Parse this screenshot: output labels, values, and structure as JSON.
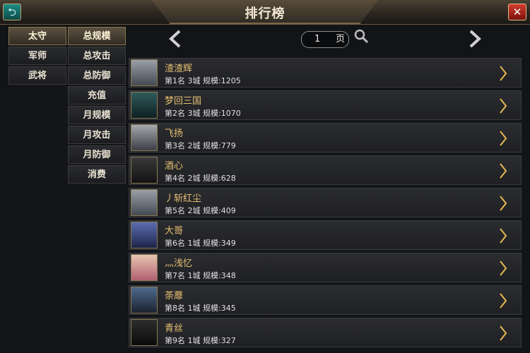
{
  "window": {
    "title": "排行榜"
  },
  "categories": [
    {
      "label": "太守"
    },
    {
      "label": "军师"
    },
    {
      "label": "武将"
    }
  ],
  "rank_types": [
    {
      "label": "总规模"
    },
    {
      "label": "总攻击"
    },
    {
      "label": "总防御"
    },
    {
      "label": "充值"
    },
    {
      "label": "月规模"
    },
    {
      "label": "月攻击"
    },
    {
      "label": "月防御"
    },
    {
      "label": "消费"
    }
  ],
  "pager": {
    "page": "1",
    "unit": "页"
  },
  "rows": [
    {
      "name": "渣渣辉",
      "info": "第1名 3城 规模:1205",
      "avatar": "helmet-warrior"
    },
    {
      "name": "梦回三国",
      "info": "第2名 3城 规模:1070",
      "avatar": "bearded-general"
    },
    {
      "name": "飞扬",
      "info": "第3名 2城 规模:779",
      "avatar": "silver-helmet-warrior"
    },
    {
      "name": "酒心",
      "info": "第4名 2城 规模:628",
      "avatar": "dark-haired-man"
    },
    {
      "name": "丿斩红尘",
      "info": "第5名 2城 规模:409",
      "avatar": "helmet-warrior"
    },
    {
      "name": "大哥",
      "info": "第6名 1城 规模:349",
      "avatar": "young-officer"
    },
    {
      "name": "灬浅忆",
      "info": "第7名 1城 规模:348",
      "avatar": "lady-pink"
    },
    {
      "name": "荼蘼",
      "info": "第8名 1城 规模:345",
      "avatar": "lady-dark"
    },
    {
      "name": "青丝",
      "info": "第9名 1城 规模:327",
      "avatar": "dark-haired-man"
    }
  ],
  "colors": {
    "accent": "#e6c071",
    "frame_gold": "#8a7650",
    "close_red": "#c0302a",
    "back_teal": "#1f8d87"
  }
}
